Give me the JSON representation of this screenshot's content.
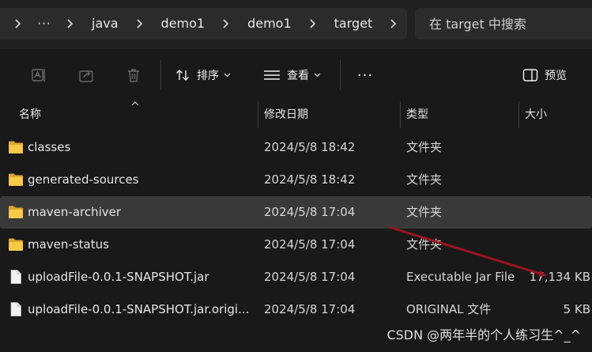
{
  "address_bar": {
    "more": "···",
    "breadcrumbs": [
      "java",
      "demo1",
      "demo1",
      "target"
    ]
  },
  "search": {
    "placeholder": "在 target 中搜索"
  },
  "toolbar": {
    "sort_label": "排序",
    "view_label": "查看",
    "more_label": "···",
    "preview_label": "预览"
  },
  "columns": {
    "name": "名称",
    "date": "修改日期",
    "type": "类型",
    "size": "大小"
  },
  "files": [
    {
      "name": "classes",
      "date": "2024/5/8 18:42",
      "type": "文件夹",
      "size": "",
      "icon": "folder-icon"
    },
    {
      "name": "generated-sources",
      "date": "2024/5/8 18:42",
      "type": "文件夹",
      "size": "",
      "icon": "folder-icon"
    },
    {
      "name": "maven-archiver",
      "date": "2024/5/8 17:04",
      "type": "文件夹",
      "size": "",
      "icon": "folder-icon",
      "selected": true
    },
    {
      "name": "maven-status",
      "date": "2024/5/8 17:04",
      "type": "文件夹",
      "size": "",
      "icon": "folder-icon"
    },
    {
      "name": "uploadFile-0.0.1-SNAPSHOT.jar",
      "date": "2024/5/8 17:04",
      "type": "Executable Jar File",
      "size": "17,134 KB",
      "icon": "file-icon"
    },
    {
      "name": "uploadFile-0.0.1-SNAPSHOT.jar.origi...",
      "date": "2024/5/8 17:04",
      "type": "ORIGINAL 文件",
      "size": "5 KB",
      "icon": "file-icon"
    }
  ],
  "watermark": "CSDN @两年半的个人练习生^_^",
  "colors": {
    "background": "#191919",
    "bar": "#2b2b2b",
    "selected_row": "#393939",
    "folder": "#f2c14e",
    "arrow": "#9b1420"
  }
}
